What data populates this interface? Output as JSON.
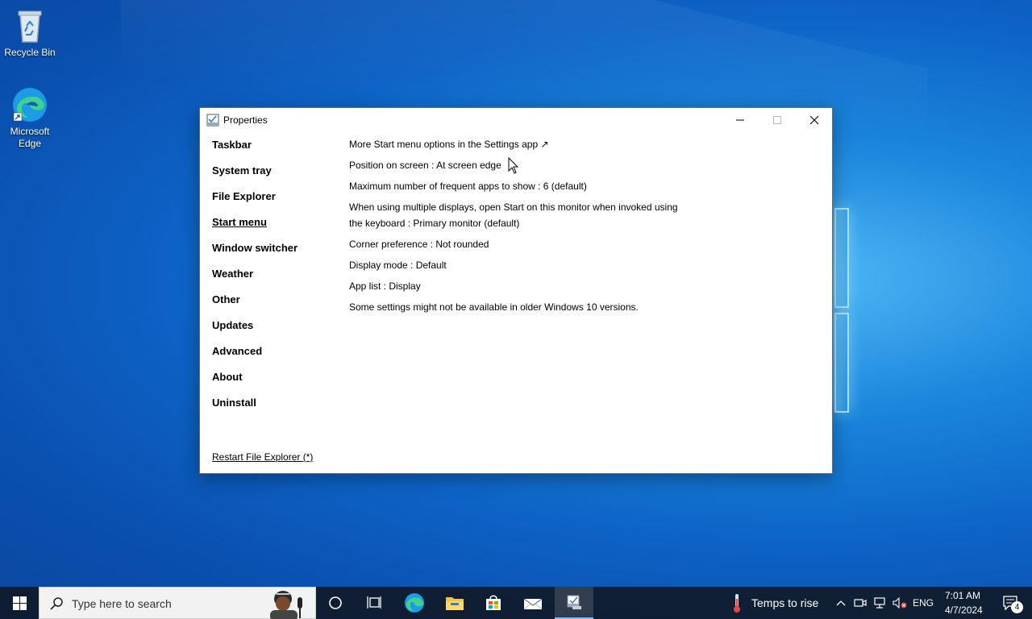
{
  "desktop": {
    "icons": [
      {
        "label": "Recycle Bin"
      },
      {
        "label": "Microsoft Edge"
      }
    ]
  },
  "window": {
    "title": "Properties",
    "nav": [
      {
        "label": "Taskbar"
      },
      {
        "label": "System tray"
      },
      {
        "label": "File Explorer"
      },
      {
        "label": "Start menu"
      },
      {
        "label": "Window switcher"
      },
      {
        "label": "Weather"
      },
      {
        "label": "Other"
      },
      {
        "label": "Updates"
      },
      {
        "label": "Advanced"
      },
      {
        "label": "About"
      },
      {
        "label": "Uninstall"
      }
    ],
    "active_nav": "Start menu",
    "restart_link": "Restart File Explorer (*)",
    "options": [
      {
        "text": "More Start menu options in the Settings app ↗"
      },
      {
        "text": "Position on screen : At screen edge"
      },
      {
        "text": "Maximum number of frequent apps to show : 6 (default)"
      },
      {
        "text": "When using multiple displays, open Start on this monitor when invoked using the keyboard : Primary monitor (default)"
      },
      {
        "text": "Corner preference : Not rounded"
      },
      {
        "text": "Display mode : Default"
      },
      {
        "text": "App list : Display"
      },
      {
        "text": "Some settings might not be available in older Windows 10 versions."
      }
    ]
  },
  "taskbar": {
    "search_placeholder": "Type here to search",
    "weather_text": "Temps to rise",
    "language": "ENG",
    "time": "7:01 AM",
    "date": "4/7/2024",
    "notification_count": "4"
  },
  "colors": {
    "taskbar_bg": "#101a28",
    "accent": "#7fb9ef",
    "desktop": "#0d63c6"
  }
}
